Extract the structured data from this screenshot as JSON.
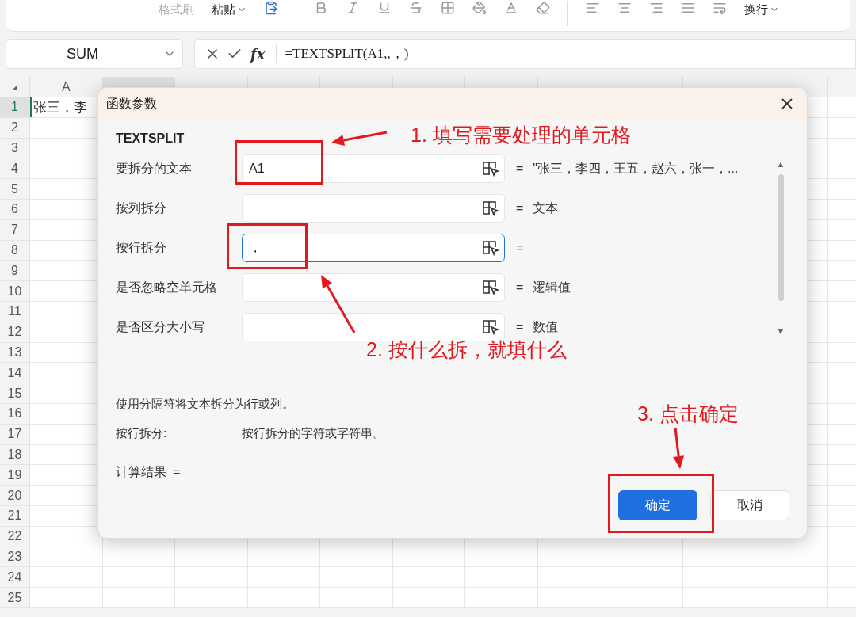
{
  "toolbar": {
    "format_painter": "格式刷",
    "paste": "粘贴",
    "wrap": "换行"
  },
  "formula_bar": {
    "name_box": "SUM",
    "fx": "fx",
    "formula": "=TEXTSPLIT(A1,,，)"
  },
  "sheet": {
    "column_a": "A",
    "rows": [
      {
        "label": "1",
        "selected": true
      },
      {
        "label": "2",
        "selected": false
      },
      {
        "label": "3",
        "selected": false
      },
      {
        "label": "4",
        "selected": false
      },
      {
        "label": "5",
        "selected": false
      },
      {
        "label": "6",
        "selected": false
      },
      {
        "label": "7",
        "selected": false
      },
      {
        "label": "8",
        "selected": false
      },
      {
        "label": "9",
        "selected": false
      },
      {
        "label": "10",
        "selected": false
      },
      {
        "label": "11",
        "selected": false
      },
      {
        "label": "12",
        "selected": false
      },
      {
        "label": "13",
        "selected": false
      },
      {
        "label": "14",
        "selected": false
      },
      {
        "label": "15",
        "selected": false
      },
      {
        "label": "16",
        "selected": false
      },
      {
        "label": "17",
        "selected": false
      },
      {
        "label": "18",
        "selected": false
      },
      {
        "label": "19",
        "selected": false
      },
      {
        "label": "20",
        "selected": false
      },
      {
        "label": "21",
        "selected": false
      },
      {
        "label": "22",
        "selected": false
      },
      {
        "label": "23",
        "selected": false
      },
      {
        "label": "24",
        "selected": false
      },
      {
        "label": "25",
        "selected": false
      }
    ],
    "cell_a1": "张三，李"
  },
  "dialog": {
    "title": "函数参数",
    "function_name": "TEXTSPLIT",
    "params": [
      {
        "label": "要拆分的文本",
        "value": "A1",
        "result": "\"张三，李四，王五，赵六，张一，...",
        "focused": false
      },
      {
        "label": "按列拆分",
        "result": "文本",
        "focused": false
      },
      {
        "label": "按行拆分",
        "value": "，",
        "focused": true
      },
      {
        "label": "是否忽略空单元格",
        "result": "逻辑值",
        "focused": false
      },
      {
        "label": "是否区分大小写",
        "result": "数值",
        "focused": false
      }
    ],
    "description": "使用分隔符将文本拆分为行或列。",
    "param_help_label": "按行拆分:",
    "param_help_text": "按行拆分的字符或字符串。",
    "result_label": "计算结果",
    "result_equals": "=",
    "equals": "=",
    "scroll_up": "▲",
    "scroll_down": "▼",
    "buttons": [
      {
        "label": "确定",
        "primary": true
      },
      {
        "label": "取消",
        "primary": false
      }
    ]
  },
  "annotations": [
    "1. 填写需要处理的单元格",
    "2. 按什么拆，就填什么",
    "3. 点击确定"
  ]
}
